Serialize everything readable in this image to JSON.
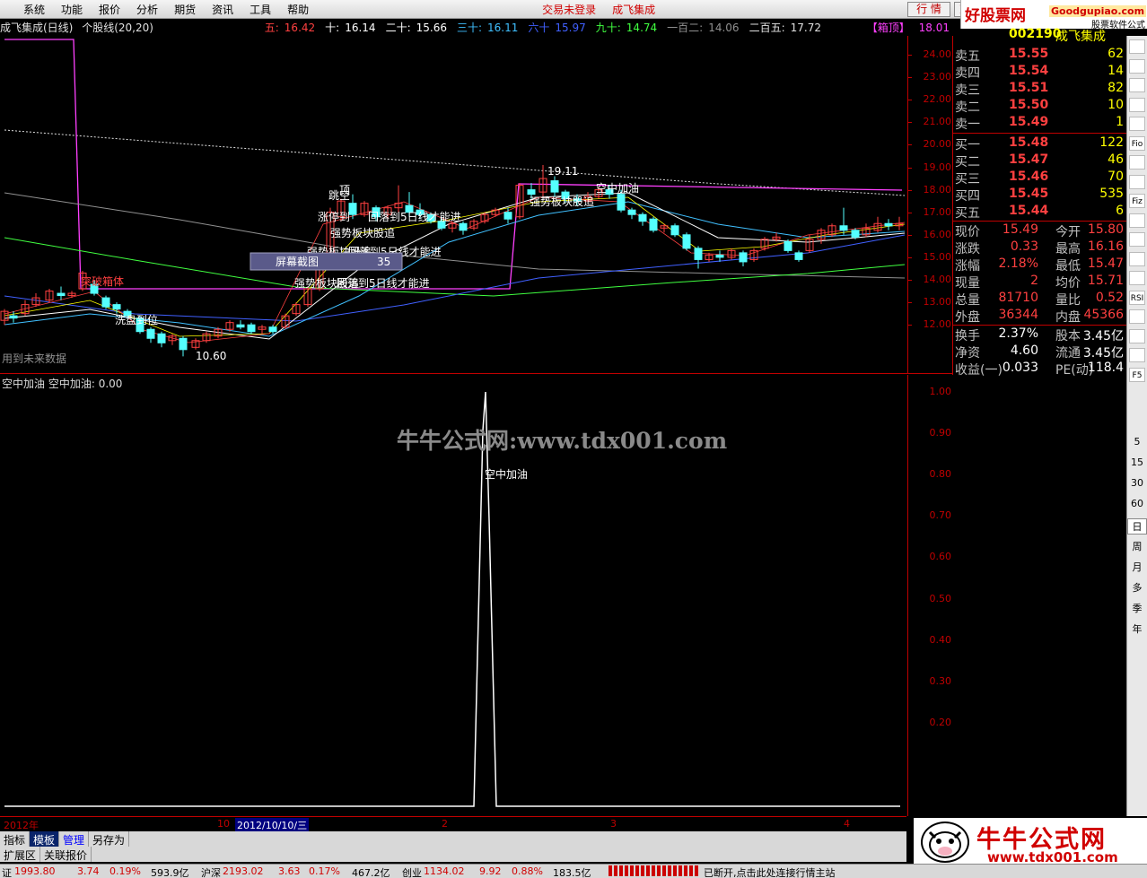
{
  "menu": {
    "items": [
      "系统",
      "功能",
      "报价",
      "分析",
      "期货",
      "资讯",
      "工具",
      "帮助"
    ],
    "login": "交易未登录",
    "stock": "成飞集成",
    "btn_quote": "行 情",
    "btn_mode": "交"
  },
  "brand": {
    "site": "好股票网",
    "url": "Goodgupiao.com",
    "sub": "股票软件公式"
  },
  "title": {
    "name": "成飞集成(日线)",
    "kind": "个股线(20,20)",
    "ma": [
      {
        "label": "五:",
        "value": "16.42",
        "color": "#ff4040"
      },
      {
        "label": "十:",
        "value": "16.14",
        "color": "#ffffff"
      },
      {
        "label": "二十:",
        "value": "15.66",
        "color": "#ffffff"
      },
      {
        "label": "三十:",
        "value": "16.11",
        "color": "#40c0ff"
      },
      {
        "label": "六十",
        "value": "15.97",
        "color": "#4060ff"
      },
      {
        "label": "九十:",
        "value": "14.74",
        "color": "#40ff40"
      },
      {
        "label": "一百二:",
        "value": "14.06",
        "color": "#909090"
      },
      {
        "label": "二百五:",
        "value": "17.72",
        "color": "#e0e0e0"
      }
    ],
    "box": "【箱顶】",
    "box_value": "18.01"
  },
  "yaxis": [
    "24.00",
    "23.00",
    "22.00",
    "21.00",
    "20.00",
    "19.00",
    "18.00",
    "17.00",
    "16.00",
    "15.00",
    "14.00",
    "13.00",
    "12.00"
  ],
  "annotations": {
    "high": "19.11",
    "low": "10.60",
    "a1": "涨停到",
    "a2": "顶",
    "a3": "突破箱体",
    "a4": "跳空",
    "a5": "强势板块股追",
    "a6": "回落到5日线才能进",
    "a7": "空中加油",
    "a8": "洗盘到位",
    "a9": "用到未来数据",
    "screenshot": "屏幕截图",
    "screenshot_num": "35",
    "a10": "强势板块股追",
    "a11": "强势板块股追",
    "a12": "回落到5日线才能进",
    "a13": "回落到5日线才能进"
  },
  "sub": {
    "title": "空中加油",
    "title_value": "空中加油: 0.00",
    "label": "空中加油",
    "yaxis": [
      "1.00",
      "0.90",
      "0.80",
      "0.70",
      "0.60",
      "0.50",
      "0.40",
      "0.30",
      "0.20"
    ]
  },
  "watermark": "牛牛公式网:www.tdx001.com",
  "timeaxis": {
    "year": "2012年",
    "m10": "10",
    "date": "2012/10/10/三",
    "m2": "2",
    "m3": "3",
    "m4": "4"
  },
  "tabs": [
    "指标",
    "模板",
    "管理",
    "另存为"
  ],
  "tabs2": [
    "扩展区",
    "关联报价"
  ],
  "quote": {
    "code": "002190",
    "name": "成飞集成",
    "sell": [
      {
        "l": "卖五",
        "p": "15.55",
        "v": "62"
      },
      {
        "l": "卖四",
        "p": "15.54",
        "v": "14"
      },
      {
        "l": "卖三",
        "p": "15.51",
        "v": "82"
      },
      {
        "l": "卖二",
        "p": "15.50",
        "v": "10"
      },
      {
        "l": "卖一",
        "p": "15.49",
        "v": "1"
      }
    ],
    "buy": [
      {
        "l": "买一",
        "p": "15.48",
        "v": "122"
      },
      {
        "l": "买二",
        "p": "15.47",
        "v": "46"
      },
      {
        "l": "买三",
        "p": "15.46",
        "v": "70"
      },
      {
        "l": "买四",
        "p": "15.45",
        "v": "535"
      },
      {
        "l": "买五",
        "p": "15.44",
        "v": "6"
      }
    ],
    "stats": [
      {
        "l1": "现价",
        "v1": "15.49",
        "l2": "今开",
        "v2": "15.80"
      },
      {
        "l1": "涨跌",
        "v1": "0.33",
        "l2": "最高",
        "v2": "16.16"
      },
      {
        "l1": "涨幅",
        "v1": "2.18%",
        "l2": "最低",
        "v2": "15.47"
      },
      {
        "l1": "现量",
        "v1": "2",
        "l2": "均价",
        "v2": "15.71"
      },
      {
        "l1": "总量",
        "v1": "81710",
        "l2": "量比",
        "v2": "0.52"
      },
      {
        "l1": "外盘",
        "v1": "36344",
        "l2": "内盘",
        "v2": "45366"
      }
    ],
    "stats2": [
      {
        "l1": "换手",
        "v1": "2.37%",
        "l2": "股本",
        "v2": "3.45亿"
      },
      {
        "l1": "净资",
        "v1": "4.60",
        "l2": "流通",
        "v2": "3.45亿"
      },
      {
        "l1": "收益(一)",
        "v1": "0.033",
        "l2": "PE(动)",
        "v2": "118.4"
      }
    ]
  },
  "rtool": {
    "periods": [
      "5",
      "15",
      "30",
      "60",
      "日",
      "周",
      "月",
      "多",
      "季",
      "年"
    ],
    "icons": [
      "Fio",
      "Fiz",
      "RSI",
      "F5"
    ]
  },
  "logo": {
    "name": "牛牛公式网",
    "url": "www.tdx001.com"
  },
  "status": {
    "sh": "证",
    "sh_v": "1993.80",
    "sh_c": "3.74",
    "sh_p": "0.19%",
    "sh_a": "593.9亿",
    "sz": "沪深",
    "sz_v": "2193.02",
    "sz_c": "3.63",
    "sz_p": "0.17%",
    "sz_a": "467.2亿",
    "cy": "创业",
    "cy_v": "1134.02",
    "cy_c": "9.92",
    "cy_p": "0.88%",
    "cy_a": "183.5亿",
    "msg": "已断开,点击此处连接行情主站"
  },
  "colors": {
    "up": "#ff4040",
    "down": "#54ffff",
    "axis": "#c00000",
    "magenta": "#ff40ff"
  }
}
